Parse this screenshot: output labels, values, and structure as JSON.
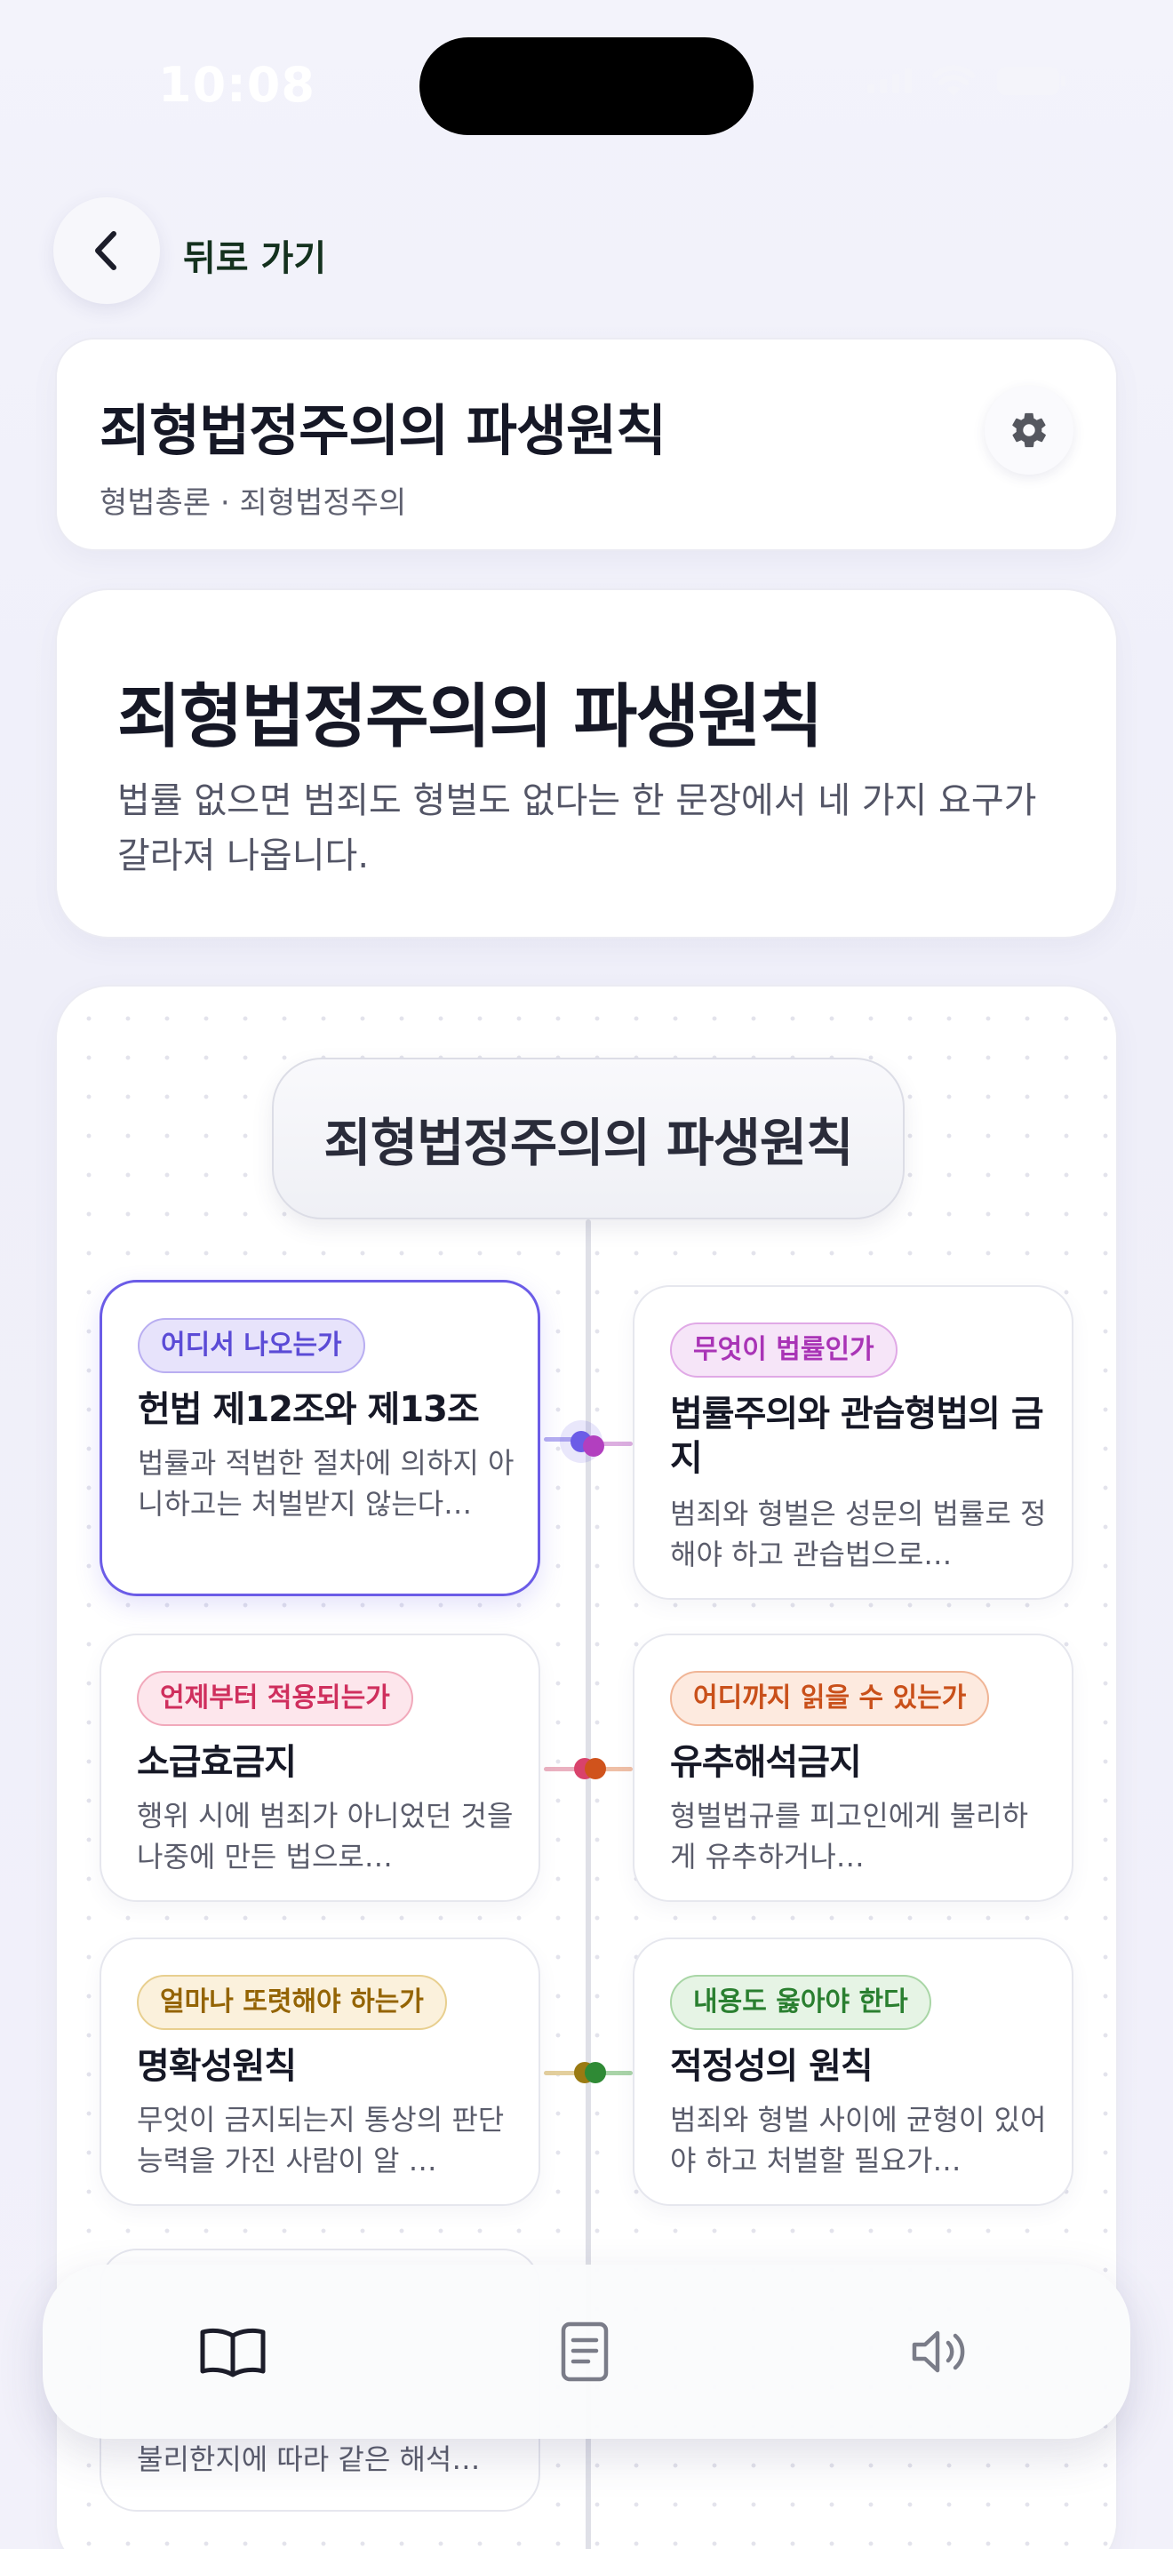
{
  "status": {
    "time": "10:08"
  },
  "nav": {
    "back_label": "뒤로 가기"
  },
  "header": {
    "title": "죄형법정주의의 파생원칙",
    "breadcrumb": "형법총론 · 죄형법정주의"
  },
  "intro": {
    "title": "죄형법정주의의 파생원칙",
    "description": "법률 없으면 범죄도 형벌도 없다는 한 문장에서 네 가지 요구가 갈라져 나옵니다."
  },
  "mindmap": {
    "root": "죄형법정주의의 파생원칙",
    "nodes": [
      {
        "tag": "어디서 나오는가",
        "title": "헌법 제12조와 제13조",
        "desc": "법률과 적법한 절차에 의하지 아니하고는 처벌받지 않는다…",
        "accent": "#6b5ce7",
        "active": true
      },
      {
        "tag": "무엇이 법률인가",
        "title": "법률주의와 관습형법의 금지",
        "desc": "범죄와 형벌은 성문의 법률로 정해야 하고 관습법으로…",
        "accent": "#b23fbf",
        "active": false
      },
      {
        "tag": "언제부터 적용되는가",
        "title": "소급효금지",
        "desc": "행위 시에 범죄가 아니었던 것을 나중에 만든 법으로…",
        "accent": "#d9426b",
        "active": false
      },
      {
        "tag": "어디까지 읽을 수 있는가",
        "title": "유추해석금지",
        "desc": "형벌법규를 피고인에게 불리하게 유추하거나…",
        "accent": "#d0531c",
        "active": false
      },
      {
        "tag": "얼마나 또렷해야 하는가",
        "title": "명확성원칙",
        "desc": "무엇이 금지되는지 통상의 판단능력을 가진 사람이 알 …",
        "accent": "#9a6a06",
        "active": false
      },
      {
        "tag": "내용도 옳아야 한다",
        "title": "적정성의 원칙",
        "desc": "범죄와 형벌 사이에 균형이 있어야 하고 처벌할 필요가…",
        "accent": "#2f8a35",
        "active": false
      }
    ],
    "partial_desc": "불리한지에 따라 같은 해석…"
  },
  "tabbar": {
    "items": [
      "book-icon",
      "document-icon",
      "speaker-icon"
    ]
  }
}
